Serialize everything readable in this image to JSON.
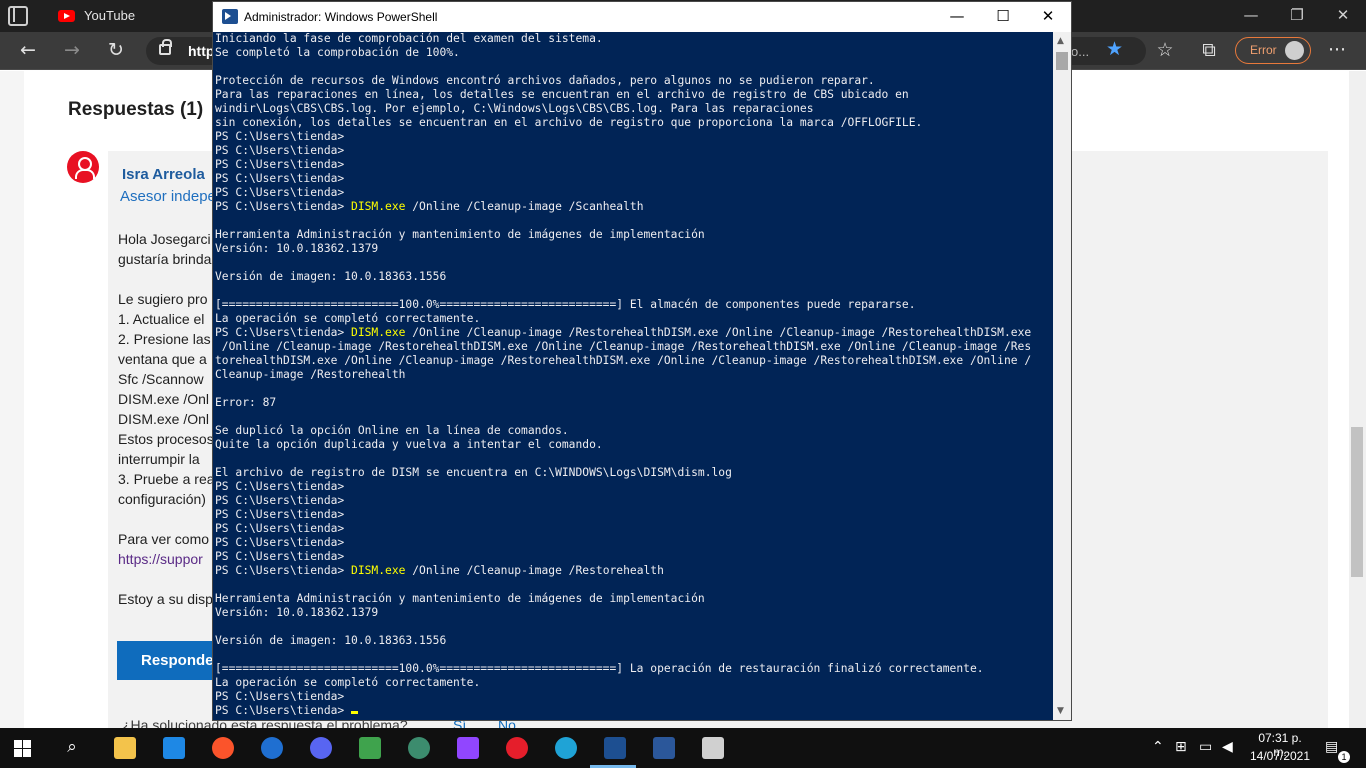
{
  "browser": {
    "tab_title": "YouTube",
    "url_prefix": "https",
    "url_tail": "o...",
    "profile_label": "Error",
    "icons": {
      "back": "←",
      "forward": "→",
      "refresh": "↻",
      "favorite": "★",
      "collections": "☆",
      "tab_add": "⧉",
      "more": "···",
      "minimize": "—",
      "restore": "❐",
      "close": "✕"
    }
  },
  "page": {
    "heading": "Respuestas (1)",
    "user_name": "Isra Arreola",
    "user_role": "Asesor indepe",
    "body_lines": [
      "Hola Josegarci",
      "gustaría brinda",
      "",
      "Le sugiero pro",
      "1. Actualice el",
      "2. Presione las",
      "ventana que a",
      "Sfc /Scannow",
      "DISM.exe /Onl",
      "DISM.exe /Onl",
      "Estos procesos",
      "interrumpir la",
      "3. Pruebe a rea",
      "configuración)",
      "",
      "Para ver como",
      "https://suppor",
      "",
      "Estoy a su disp"
    ],
    "reply_button": "Responder",
    "helpful_question": "¿Ha solucionado esta respuesta el problema?",
    "yes": "Sí",
    "no": "No"
  },
  "powershell": {
    "title": "Administrador: Windows PowerShell",
    "controls": {
      "minimize": "—",
      "maximize": "☐",
      "close": "✕"
    },
    "lines": [
      {
        "t": "Iniciando la fase de comprobación del examen del sistema."
      },
      {
        "t": "Se completó la comprobación de 100%."
      },
      {
        "t": ""
      },
      {
        "t": "Protección de recursos de Windows encontró archivos dañados, pero algunos no se pudieron reparar."
      },
      {
        "t": "Para las reparaciones en línea, los detalles se encuentran en el archivo de registro de CBS ubicado en"
      },
      {
        "t": "windir\\Logs\\CBS\\CBS.log. Por ejemplo, C:\\Windows\\Logs\\CBS\\CBS.log. Para las reparaciones"
      },
      {
        "t": "sin conexión, los detalles se encuentran en el archivo de registro que proporciona la marca /OFFLOGFILE."
      },
      {
        "t": "PS C:\\Users\\tienda>"
      },
      {
        "t": "PS C:\\Users\\tienda>"
      },
      {
        "t": "PS C:\\Users\\tienda>"
      },
      {
        "t": "PS C:\\Users\\tienda>"
      },
      {
        "t": "PS C:\\Users\\tienda>"
      },
      {
        "t": "PS C:\\Users\\tienda> ",
        "c": "DISM.exe",
        "r": " /Online /Cleanup-image /Scanhealth"
      },
      {
        "t": ""
      },
      {
        "t": "Herramienta Administración y mantenimiento de imágenes de implementación"
      },
      {
        "t": "Versión: 10.0.18362.1379"
      },
      {
        "t": ""
      },
      {
        "t": "Versión de imagen: 10.0.18363.1556"
      },
      {
        "t": ""
      },
      {
        "t": "[==========================100.0%==========================] El almacén de componentes puede repararse."
      },
      {
        "t": "La operación se completó correctamente."
      },
      {
        "t": "PS C:\\Users\\tienda> ",
        "c": "DISM.exe",
        "r": " /Online /Cleanup-image /RestorehealthDISM.exe /Online /Cleanup-image /RestorehealthDISM.exe"
      },
      {
        "t": " /Online /Cleanup-image /RestorehealthDISM.exe /Online /Cleanup-image /RestorehealthDISM.exe /Online /Cleanup-image /Res"
      },
      {
        "t": "torehealthDISM.exe /Online /Cleanup-image /RestorehealthDISM.exe /Online /Cleanup-image /RestorehealthDISM.exe /Online /"
      },
      {
        "t": "Cleanup-image /Restorehealth"
      },
      {
        "t": ""
      },
      {
        "t": "Error: 87"
      },
      {
        "t": ""
      },
      {
        "t": "Se duplicó la opción Online en la línea de comandos."
      },
      {
        "t": "Quite la opción duplicada y vuelva a intentar el comando."
      },
      {
        "t": ""
      },
      {
        "t": "El archivo de registro de DISM se encuentra en C:\\WINDOWS\\Logs\\DISM\\dism.log"
      },
      {
        "t": "PS C:\\Users\\tienda>"
      },
      {
        "t": "PS C:\\Users\\tienda>"
      },
      {
        "t": "PS C:\\Users\\tienda>"
      },
      {
        "t": "PS C:\\Users\\tienda>"
      },
      {
        "t": "PS C:\\Users\\tienda>"
      },
      {
        "t": "PS C:\\Users\\tienda>"
      },
      {
        "t": "PS C:\\Users\\tienda> ",
        "c": "DISM.exe",
        "r": " /Online /Cleanup-image /Restorehealth"
      },
      {
        "t": ""
      },
      {
        "t": "Herramienta Administración y mantenimiento de imágenes de implementación"
      },
      {
        "t": "Versión: 10.0.18362.1379"
      },
      {
        "t": ""
      },
      {
        "t": "Versión de imagen: 10.0.18363.1556"
      },
      {
        "t": ""
      },
      {
        "t": "[==========================100.0%==========================] La operación de restauración finalizó correctamente."
      },
      {
        "t": "La operación se completó correctamente."
      },
      {
        "t": "PS C:\\Users\\tienda>"
      },
      {
        "t": "PS C:\\Users\\tienda> ",
        "cursor": true
      }
    ]
  },
  "taskbar": {
    "time": "07:31 p. m.",
    "date": "14/07/2021",
    "notification_count": "1",
    "apps": [
      {
        "name": "search-icon",
        "glyph": "⌕"
      },
      {
        "name": "file-explorer-icon",
        "color": "#f3c34b"
      },
      {
        "name": "mail-icon",
        "color": "#1e88e5"
      },
      {
        "name": "brave-icon",
        "color": "#fb542b"
      },
      {
        "name": "calculator-app-icon",
        "color": "#1f6fd1"
      },
      {
        "name": "discord-icon",
        "color": "#5865f2"
      },
      {
        "name": "game-icon",
        "color": "#3fa34d"
      },
      {
        "name": "globe-icon",
        "color": "#3c8c6e"
      },
      {
        "name": "twitch-icon",
        "color": "#9146ff"
      },
      {
        "name": "opera-icon",
        "color": "#e51e2b"
      },
      {
        "name": "edge-icon",
        "color": "#1fa3d6"
      },
      {
        "name": "powershell-icon",
        "color": "#1d4f91"
      },
      {
        "name": "word-icon",
        "color": "#2b579a"
      },
      {
        "name": "calculator-icon",
        "color": "#d0d0d0"
      }
    ]
  }
}
